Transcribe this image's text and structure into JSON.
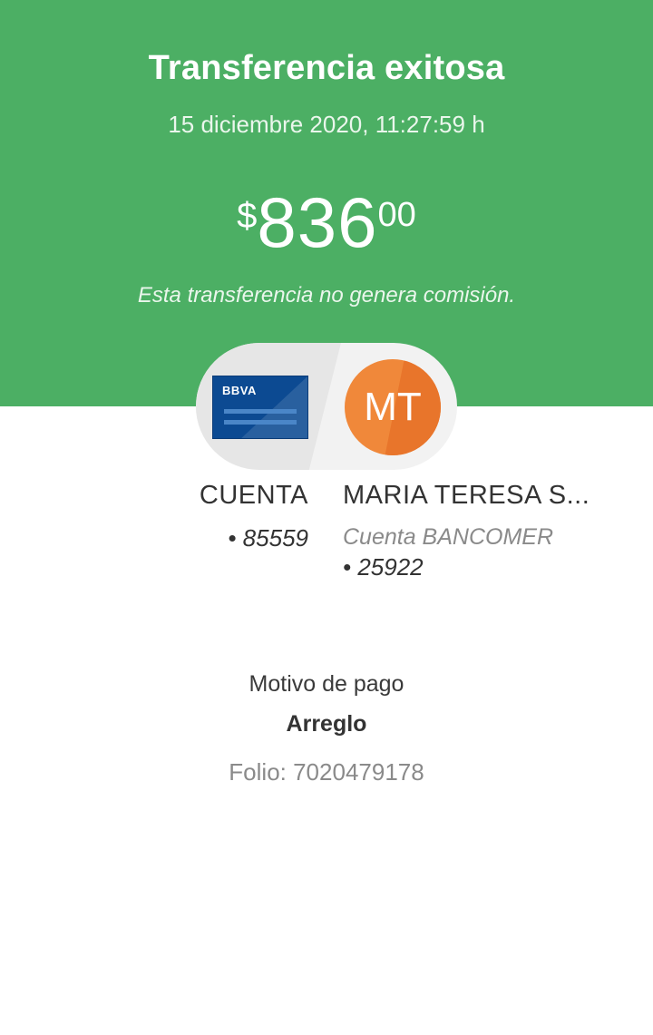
{
  "header": {
    "title": "Transferencia exitosa",
    "datetime": "15 diciembre 2020, 11:27:59 h",
    "amount": {
      "currency": "$",
      "integer": "836",
      "decimals": "00"
    },
    "commission_note": "Esta transferencia no genera comisión."
  },
  "from": {
    "bank_logo": "BBVA",
    "label": "CUENTA",
    "account": "• 85559"
  },
  "to": {
    "initials": "MT",
    "name": "MARIA TERESA S...",
    "bank": "Cuenta BANCOMER",
    "account": "• 25922"
  },
  "details": {
    "reason_label": "Motivo de pago",
    "reason_value": "Arreglo",
    "folio": "Folio: 7020479178"
  },
  "colors": {
    "header_bg": "#4caf64",
    "card_blue": "#0c4a92",
    "avatar_orange": "#f0883a"
  }
}
